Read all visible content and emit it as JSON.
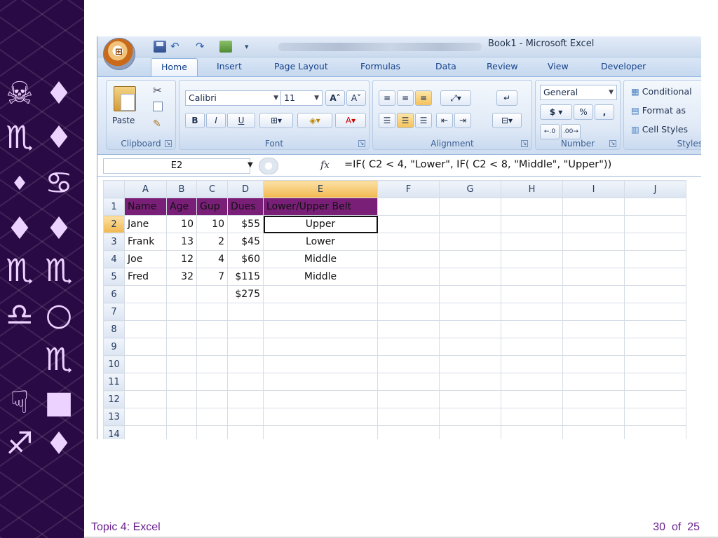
{
  "footer": {
    "topic": "Topic 4:  Excel",
    "page": "30",
    "of": "of",
    "total": "25"
  },
  "decor": {
    "glyphs": [
      "☠",
      "♦",
      "♏",
      "♦",
      "♦",
      "♋",
      "♦",
      "♦",
      "♏",
      "♏",
      "♎",
      "○",
      "♏",
      "☟",
      "■",
      "♐",
      "♦"
    ]
  },
  "excel": {
    "window_title": "Book1 - Microsoft Excel",
    "tabs": [
      "Home",
      "Insert",
      "Page Layout",
      "Formulas",
      "Data",
      "Review",
      "View",
      "Developer"
    ],
    "ribbon": {
      "clipboard": {
        "label": "Clipboard",
        "paste": "Paste"
      },
      "font": {
        "label": "Font",
        "name": "Calibri",
        "size": "11",
        "bold": "B",
        "italic": "I",
        "underline": "U"
      },
      "alignment": {
        "label": "Alignment"
      },
      "number": {
        "label": "Number",
        "format": "General",
        "currency": "$",
        "percent": "%",
        "comma": ","
      },
      "styles": {
        "label": "Styles",
        "conditional": "Conditional",
        "format_as": "Format as",
        "cell_styles": "Cell Styles"
      }
    },
    "formula_bar": {
      "name_box": "E2",
      "fx": "fx",
      "formula": "=IF( C2 < 4, \"Lower\", IF( C2 < 8, \"Middle\", \"Upper\"))"
    },
    "sheet": {
      "columns": [
        "A",
        "B",
        "C",
        "D",
        "E",
        "F",
        "G",
        "H",
        "I",
        "J"
      ],
      "rows": [
        "1",
        "2",
        "3",
        "4",
        "5",
        "6",
        "7",
        "8",
        "9",
        "10",
        "11",
        "12",
        "13",
        "14"
      ],
      "header_row": [
        "Name",
        "Age",
        "Gup",
        "Dues",
        "Lower/Upper Belt"
      ],
      "data": [
        [
          "Jane",
          "10",
          "10",
          "$55",
          "Upper"
        ],
        [
          "Frank",
          "13",
          "2",
          "$45",
          "Lower"
        ],
        [
          "Joe",
          "12",
          "4",
          "$60",
          "Middle"
        ],
        [
          "Fred",
          "32",
          "7",
          "$115",
          "Middle"
        ]
      ],
      "total_dues": "$275",
      "active_cell": "E2"
    }
  }
}
